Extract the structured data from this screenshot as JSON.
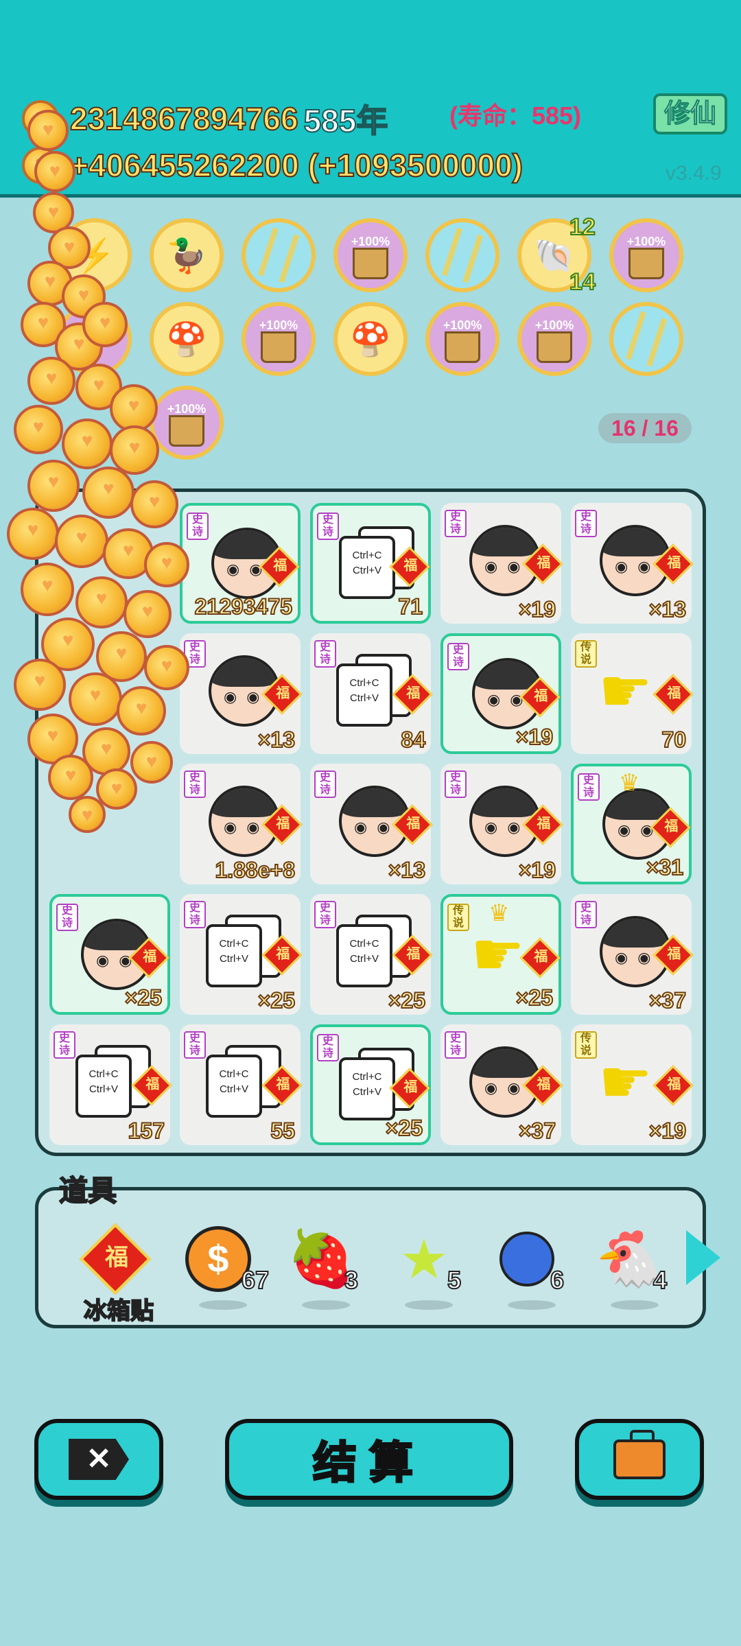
{
  "header": {
    "coins": "2314867894766",
    "years": "585年",
    "lifespan": "(寿命：585)",
    "income": "+406455262200 (+1093500000)",
    "cultivate_label": "修仙",
    "version": "v3.4.9"
  },
  "buffs": {
    "buff_label": "+100%",
    "badge_top": "12",
    "badge_bottom": "14",
    "slot_counter": "16 / 16"
  },
  "board": {
    "cells": [
      {
        "tag": "史诗",
        "kind": "face",
        "count": "21293475",
        "glow": true
      },
      {
        "tag": "史诗",
        "kind": "copy",
        "count": "71",
        "glow": true
      },
      {
        "tag": "史诗",
        "kind": "face",
        "count": "×19",
        "glow": false
      },
      {
        "tag": "史诗",
        "kind": "face",
        "count": "×13",
        "glow": false
      },
      {
        "tag": "史诗",
        "kind": "face",
        "count": "×13",
        "glow": false
      },
      {
        "tag": "史诗",
        "kind": "copy",
        "count": "84",
        "glow": false
      },
      {
        "tag": "史诗",
        "kind": "face",
        "count": "×19",
        "glow": true
      },
      {
        "tag": "传说",
        "kind": "hand",
        "count": "70",
        "glow": false
      },
      {
        "tag": "史诗",
        "kind": "face",
        "count": "1.88e+8",
        "glow": false
      },
      {
        "tag": "史诗",
        "kind": "face",
        "count": "×13",
        "glow": false
      },
      {
        "tag": "史诗",
        "kind": "face",
        "count": "×19",
        "glow": false
      },
      {
        "tag": "史诗",
        "kind": "face",
        "count": "×31",
        "glow": true
      },
      {
        "tag": "史诗",
        "kind": "face",
        "count": "×25",
        "glow": true
      },
      {
        "tag": "史诗",
        "kind": "copy",
        "count": "×25",
        "glow": false
      },
      {
        "tag": "史诗",
        "kind": "copy",
        "count": "×25",
        "glow": false
      },
      {
        "tag": "传说",
        "kind": "hand",
        "count": "×25",
        "glow": true
      },
      {
        "tag": "史诗",
        "kind": "face",
        "count": "×37",
        "glow": false
      },
      {
        "tag": "史诗",
        "kind": "copy",
        "count": "157",
        "glow": false
      },
      {
        "tag": "史诗",
        "kind": "copy",
        "count": "55",
        "glow": false
      },
      {
        "tag": "史诗",
        "kind": "copy",
        "count": "×25",
        "glow": true
      },
      {
        "tag": "史诗",
        "kind": "face",
        "count": "×37",
        "glow": false
      },
      {
        "tag": "传说",
        "kind": "hand",
        "count": "×19",
        "glow": false
      }
    ],
    "card_text_1": "Ctrl+C",
    "card_text_2": "Ctrl+V",
    "fu": "福"
  },
  "items": {
    "title": "道具",
    "fridge_sticker": "冰箱贴",
    "fu": "福",
    "coin_qty": "67",
    "strawberry_qty": "3",
    "star_qty": "5",
    "blueberry_qty": "6",
    "bird_qty": "4"
  },
  "bottom": {
    "settle_label": "结算",
    "close_symbol": "✕"
  }
}
